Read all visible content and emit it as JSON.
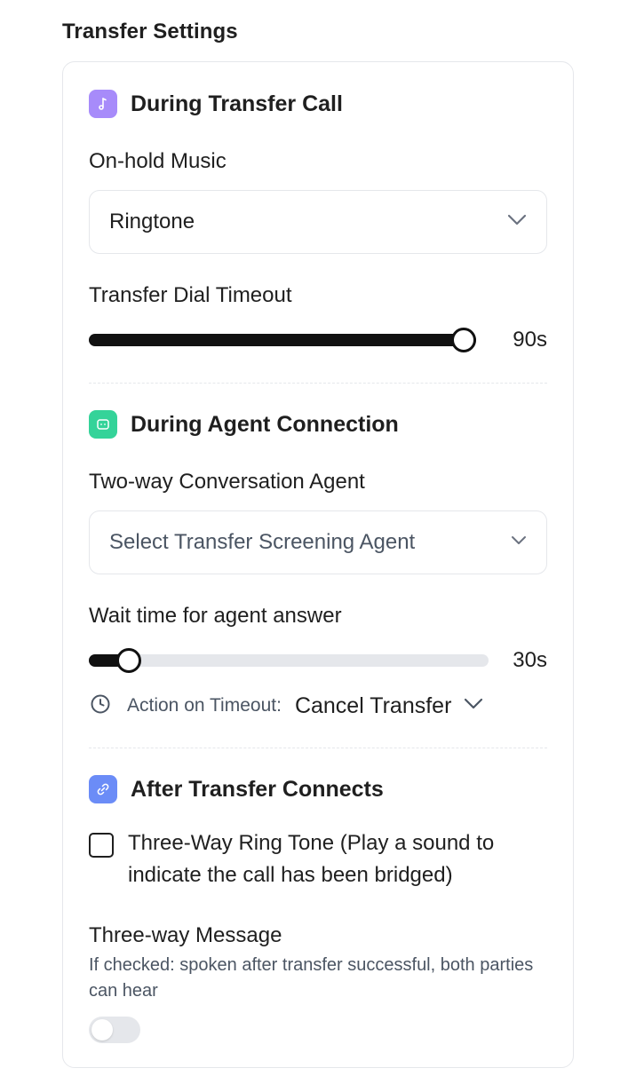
{
  "page": {
    "title": "Transfer Settings"
  },
  "sections": {
    "during_transfer": {
      "title": "During Transfer Call",
      "icon": "music-note-icon",
      "icon_color": "#a78bfa",
      "on_hold_label": "On-hold Music",
      "on_hold_value": "Ringtone",
      "dial_timeout_label": "Transfer Dial Timeout",
      "dial_timeout_value": "90s",
      "dial_timeout_fraction": 1.0
    },
    "during_agent": {
      "title": "During Agent Connection",
      "icon": "chat-bubble-icon",
      "icon_color": "#34d399",
      "agent_label": "Two-way Conversation Agent",
      "agent_placeholder": "Select Transfer Screening Agent",
      "wait_label": "Wait time for agent answer",
      "wait_value": "30s",
      "wait_fraction": 0.1,
      "timeout_action_label": "Action on Timeout:",
      "timeout_action_value": "Cancel Transfer"
    },
    "after_connect": {
      "title": "After Transfer Connects",
      "icon": "link-icon",
      "icon_color": "#6b8cf7",
      "ring_tone_label": "Three-Way Ring Tone (Play a sound to indicate the call has been bridged)",
      "ring_tone_checked": false,
      "message_label": "Three-way Message",
      "message_help": "If checked: spoken after transfer successful, both parties can hear",
      "message_enabled": false
    }
  }
}
